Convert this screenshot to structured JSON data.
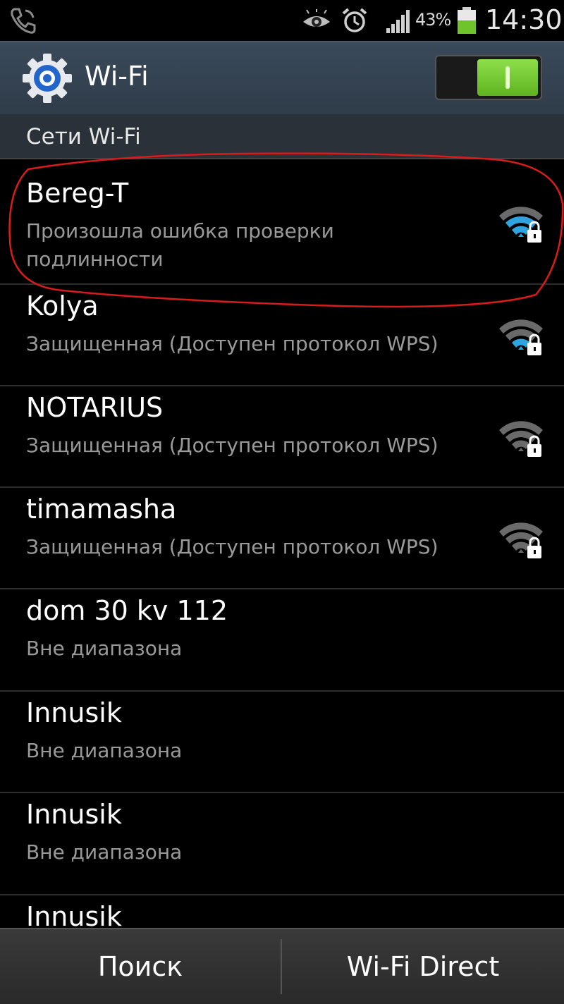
{
  "status_bar": {
    "battery_percent": "43%",
    "battery_level": 0.43,
    "time": "14:30",
    "icons": [
      "phone-icon",
      "eye-icon",
      "alarm-icon",
      "signal-icon",
      "battery-icon"
    ]
  },
  "header": {
    "title": "Wi-Fi",
    "toggle_on": true,
    "accent_color": "#6fc42b"
  },
  "section": {
    "title": "Сети Wi-Fi"
  },
  "networks": [
    {
      "name": "Bereg-T",
      "status_line1": "Произошла ошибка проверки",
      "status_line2": "подлинности",
      "signal": "secured-strong"
    },
    {
      "name": "Kolya",
      "status": "Защищенная (Доступен протокол WPS)",
      "signal": "secured-strong"
    },
    {
      "name": "NOTARIUS",
      "status": "Защищенная (Доступен протокол WPS)",
      "signal": "secured-weak"
    },
    {
      "name": "timamasha",
      "status": "Защищенная (Доступен протокол WPS)",
      "signal": "secured-weak"
    },
    {
      "name": "dom 30 kv 112",
      "status": "Вне диапазона"
    },
    {
      "name": "Innusik",
      "status": "Вне диапазона"
    },
    {
      "name": "Innusik",
      "status": "Вне диапазона"
    },
    {
      "name": "Innusik"
    }
  ],
  "bottom_bar": {
    "search_label": "Поиск",
    "direct_label": "Wi-Fi Direct"
  },
  "colors": {
    "wifi_active": "#2fa3e0",
    "wifi_inactive": "#6a6a6a",
    "annotation": "#d81c1c"
  }
}
